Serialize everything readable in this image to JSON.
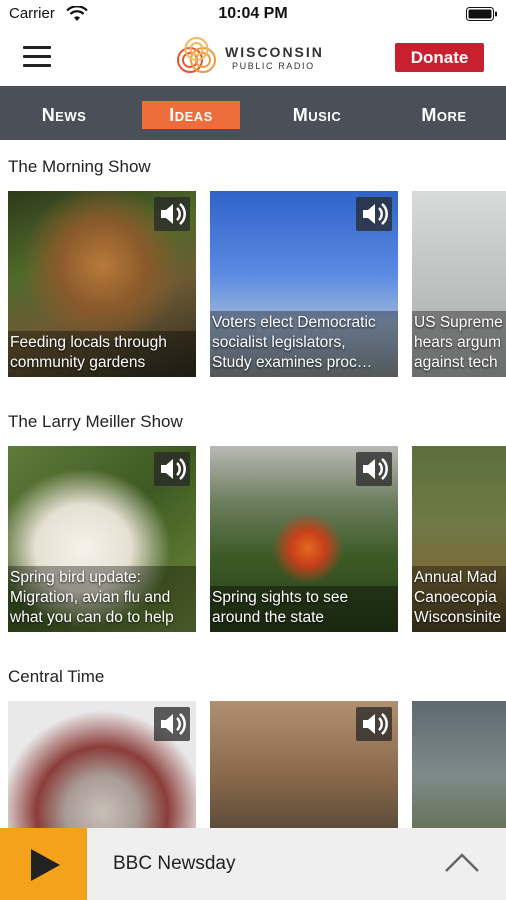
{
  "status_bar": {
    "carrier": "Carrier",
    "time": "10:04 PM"
  },
  "header": {
    "logo_line1": "WISCONSIN",
    "logo_line2": "PUBLIC RADIO",
    "donate_label": "Donate",
    "colors": {
      "donate": "#c8202f"
    }
  },
  "nav": {
    "tabs": [
      {
        "label": "News",
        "active": false
      },
      {
        "label": "Ideas",
        "active": true
      },
      {
        "label": "Music",
        "active": false
      },
      {
        "label": "More",
        "active": false
      }
    ],
    "colors": {
      "bar": "#4a4f58",
      "active": "#ef6d3b"
    }
  },
  "sections": [
    {
      "title": "The Morning Show",
      "cards": [
        {
          "caption": [
            "Feeding locals through",
            "community gardens"
          ],
          "has_audio": true
        },
        {
          "caption": [
            "Voters elect Democratic",
            "socialist legislators,",
            "Study examines proc…"
          ],
          "has_audio": true
        },
        {
          "caption": [
            "US Supreme",
            "hears argum",
            "against tech"
          ],
          "has_audio": false
        }
      ]
    },
    {
      "title": "The Larry Meiller Show",
      "cards": [
        {
          "caption": [
            "Spring bird update:",
            "Migration, avian flu and",
            "what you can do to help"
          ],
          "has_audio": true
        },
        {
          "caption": [
            "Spring sights to see",
            "around the state"
          ],
          "has_audio": true
        },
        {
          "caption": [
            "Annual Mad",
            "Canoecopia",
            "Wisconsinite"
          ],
          "has_audio": false
        }
      ]
    },
    {
      "title": "Central Time",
      "cards": [
        {
          "caption": [],
          "has_audio": true
        },
        {
          "caption": [],
          "has_audio": true
        },
        {
          "caption": [],
          "has_audio": false
        }
      ]
    }
  ],
  "player": {
    "show": "BBC Newsday",
    "colors": {
      "play_button": "#f4a21b"
    }
  }
}
